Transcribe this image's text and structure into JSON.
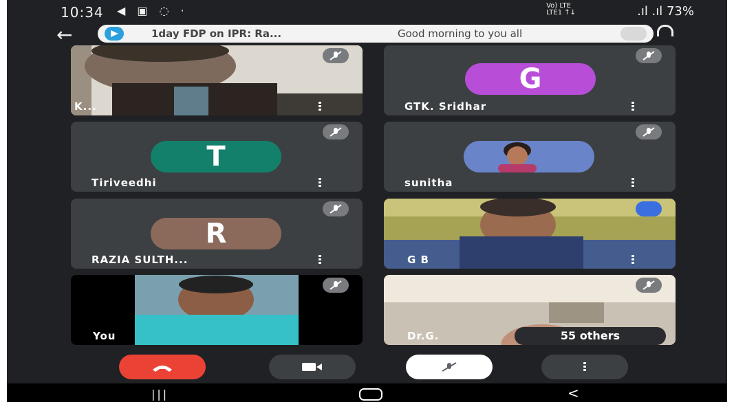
{
  "status_bar": {
    "time": "10:34",
    "network": "Vo) LTE\nLTE1 ↑↓",
    "signal_battery": ".ıl .ıl 73%"
  },
  "banner": {
    "title": "1day FDP on IPR: Ra...",
    "message": "Good morning to you all"
  },
  "participants": [
    {
      "name": "K...",
      "type": "video"
    },
    {
      "name": "GTK. Sridhar",
      "type": "avatar",
      "initial": "G",
      "color": "#b84ed8"
    },
    {
      "name": "Tiriveedhi",
      "type": "avatar",
      "initial": "T",
      "color": "#12806b"
    },
    {
      "name": "sunitha",
      "type": "photo"
    },
    {
      "name": "RAZIA SULTH...",
      "type": "avatar",
      "initial": "R",
      "color": "#8b6a5c"
    },
    {
      "name": "G B",
      "type": "video"
    },
    {
      "name": "You",
      "type": "video"
    },
    {
      "name": "Dr.G.",
      "type": "video"
    }
  ],
  "others_label": "55 others",
  "colors": {
    "end_call": "#ea4335",
    "background": "#202124",
    "tile": "#3c4043",
    "speaking": "#3b6fe0"
  }
}
